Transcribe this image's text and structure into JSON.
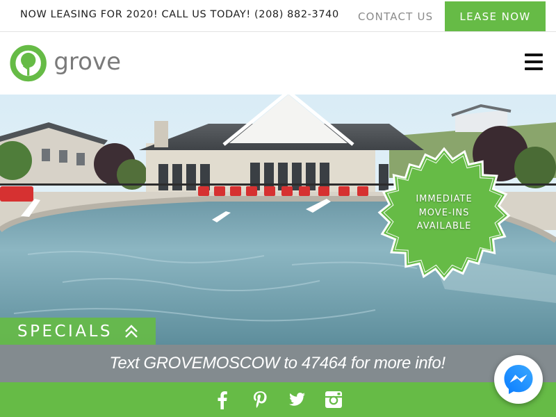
{
  "topbar": {
    "promo_text": "NOW LEASING FOR 2020! CALL US TODAY! (208) 882-3740",
    "contact_label": "CONTACT US",
    "lease_label": "LEASE NOW"
  },
  "header": {
    "brand_name": "grove",
    "menu_icon": "hamburger-menu-icon"
  },
  "hero": {
    "badge_lines": [
      "IMMEDIATE",
      "MOVE-INS",
      "AVAILABLE"
    ],
    "specials_label": "SPECIALS",
    "specials_icon": "double-chevron-up-icon"
  },
  "text_band": {
    "message": "Text GROVEMOSCOW to 47464 for more info!"
  },
  "social": {
    "icons": [
      "facebook-icon",
      "pinterest-icon",
      "twitter-icon",
      "instagram-icon"
    ]
  },
  "chat": {
    "icon": "messenger-icon"
  },
  "colors": {
    "brand_green": "#66bb46",
    "band_gray": "#838b8f",
    "text_dark": "#1d1d1d",
    "text_muted": "#8a8a8a"
  }
}
